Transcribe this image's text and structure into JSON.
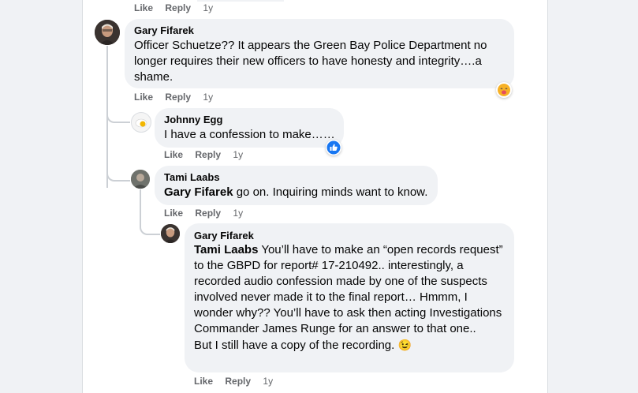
{
  "top_actions": {
    "like": "Like",
    "reply": "Reply",
    "time": "1y"
  },
  "comments": [
    {
      "author": "Gary Fifarek",
      "text": "Officer Schuetze?? It appears the Green Bay Police Department no longer requires their new officers to have honesty and integrity….a shame.",
      "like": "Like",
      "reply": "Reply",
      "time": "1y",
      "reaction": "haha-emoji-icon"
    },
    {
      "author": "Johnny Egg",
      "text": "I have a confession to make……",
      "like": "Like",
      "reply": "Reply",
      "time": "1y",
      "reaction": "like-thumb-icon"
    },
    {
      "author": "Tami Laabs",
      "mention": "Gary Fifarek",
      "text": " go on. Inquiring minds want to know.",
      "like": "Like",
      "reply": "Reply",
      "time": "1y"
    },
    {
      "author": "Gary Fifarek",
      "mention": "Tami Laabs",
      "text": " You’ll have to make an “open records request” to the GBPD for report# 17-210492.. interestingly, a recorded audio confession made by one of the suspects involved never made it to the final report… Hmmm, I wonder why?? You’ll have to ask then acting Investigations Commander James Runge for an answer to that one..",
      "text2": "But I still have a copy of the recording. ",
      "emoji": "😉",
      "like": "Like",
      "reply": "Reply",
      "time": "1y"
    }
  ],
  "colors": {
    "bubble": "#f0f2f5",
    "meta": "#65676b",
    "like_blue": "#1877f2",
    "haha_yellow": "#f7b125"
  }
}
